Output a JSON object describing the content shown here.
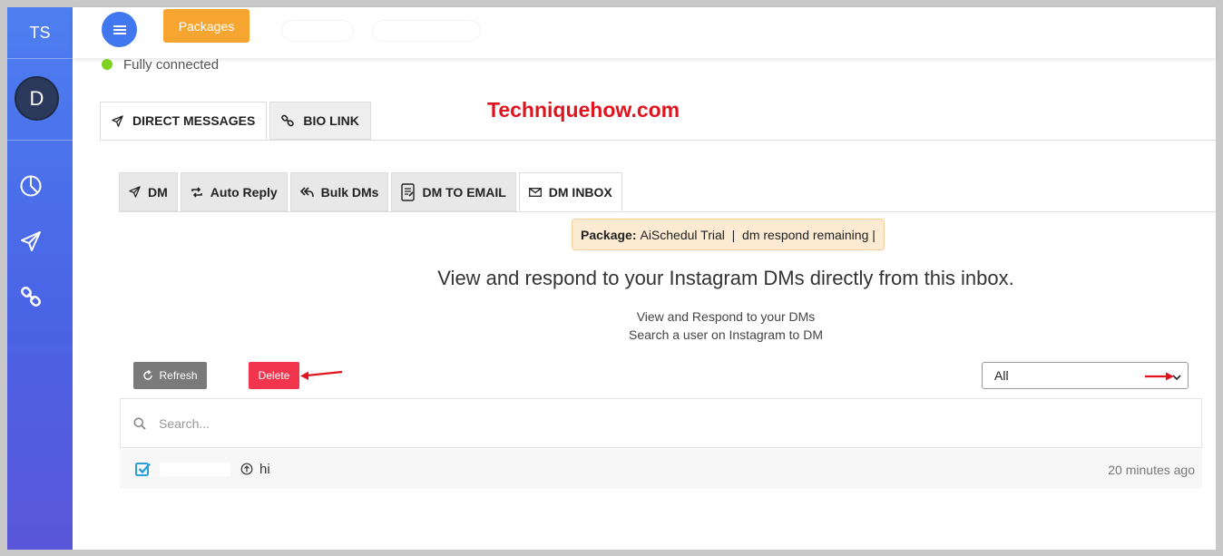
{
  "sidebar": {
    "initials": "TS",
    "avatar_letter": "D",
    "icons": [
      "pie-chart-icon",
      "paper-plane-icon",
      "link-icon"
    ]
  },
  "topbar": {
    "packages_label": "Packages"
  },
  "connection": {
    "status": "Fully connected",
    "status_color": "#7ed321"
  },
  "main_tabs": [
    {
      "label": "DIRECT MESSAGES",
      "icon": "paper-plane-icon",
      "active": true
    },
    {
      "label": "BIO LINK",
      "icon": "link-icon",
      "active": false
    }
  ],
  "watermark": "Techniquehow.com",
  "sub_tabs": [
    {
      "label": "DM",
      "icon": "paper-plane-icon",
      "active": false
    },
    {
      "label": "Auto Reply",
      "icon": "retweet-icon",
      "active": false
    },
    {
      "label": "Bulk DMs",
      "icon": "reply-all-icon",
      "active": false
    },
    {
      "label": "DM TO EMAIL",
      "icon": "email-form-icon",
      "active": false
    },
    {
      "label": "DM INBOX",
      "icon": "envelope-icon",
      "active": true
    }
  ],
  "package_banner": {
    "label": "Package:",
    "value": "AiSchedul Trial  |  dm respond remaining |"
  },
  "inbox": {
    "headline": "View and respond to your Instagram DMs directly from this inbox.",
    "line1": "View and Respond to your DMs",
    "line2": "Search a user on Instagram to DM",
    "refresh_label": "Refresh",
    "delete_label": "Delete",
    "filter_value": "All",
    "search_placeholder": "Search...",
    "messages": [
      {
        "text": "hi",
        "time": "20 minutes ago",
        "checked": true
      }
    ]
  },
  "colors": {
    "accent_blue": "#4177ef",
    "packages_orange": "#f7a531",
    "delete_red": "#f2354c",
    "refresh_gray": "#7a7a7a",
    "watermark_red": "#e0141e"
  }
}
